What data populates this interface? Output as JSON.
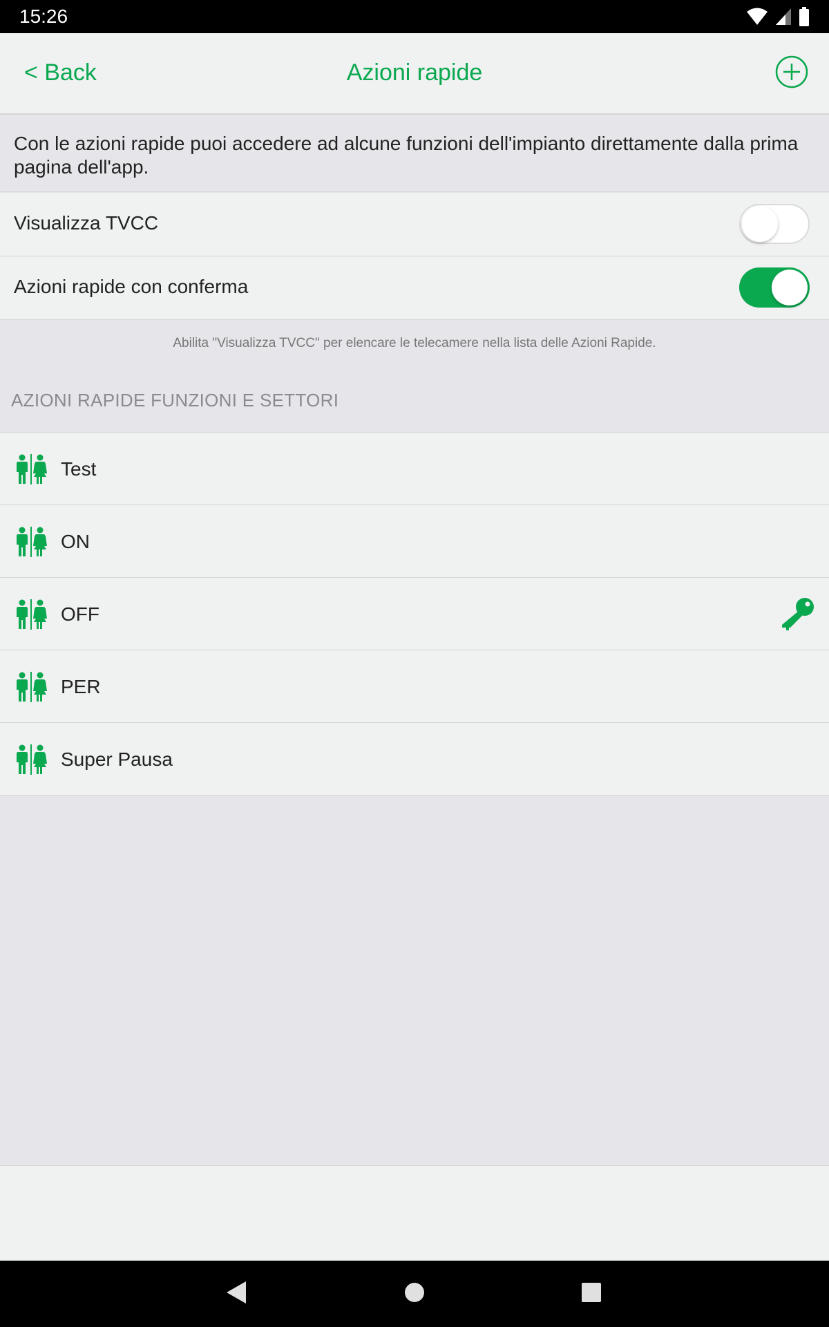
{
  "status_bar": {
    "time": "15:26"
  },
  "header": {
    "back_label": "< Back",
    "title": "Azioni rapide",
    "add_icon": "plus-circle-icon"
  },
  "description": "Con le azioni rapide puoi accedere ad alcune funzioni dell'impianto direttamente dalla prima pagina dell'app.",
  "settings": [
    {
      "label": "Visualizza TVCC",
      "enabled": false
    },
    {
      "label": "Azioni rapide con conferma",
      "enabled": true
    }
  ],
  "hint": "Abilita \"Visualizza TVCC\" per elencare le telecamere nella lista delle Azioni Rapide.",
  "section_header": "AZIONI RAPIDE FUNZIONI E SETTORI",
  "items": [
    {
      "label": "Test",
      "icon": "people-icon",
      "has_key": false
    },
    {
      "label": "ON",
      "icon": "people-icon",
      "has_key": false
    },
    {
      "label": "OFF",
      "icon": "people-icon",
      "has_key": true
    },
    {
      "label": "PER",
      "icon": "people-icon",
      "has_key": false
    },
    {
      "label": "Super Pausa",
      "icon": "people-icon",
      "has_key": false
    }
  ],
  "colors": {
    "accent": "#0aa84f",
    "background": "#e5e5ea",
    "row_background": "#f0f1f1"
  }
}
